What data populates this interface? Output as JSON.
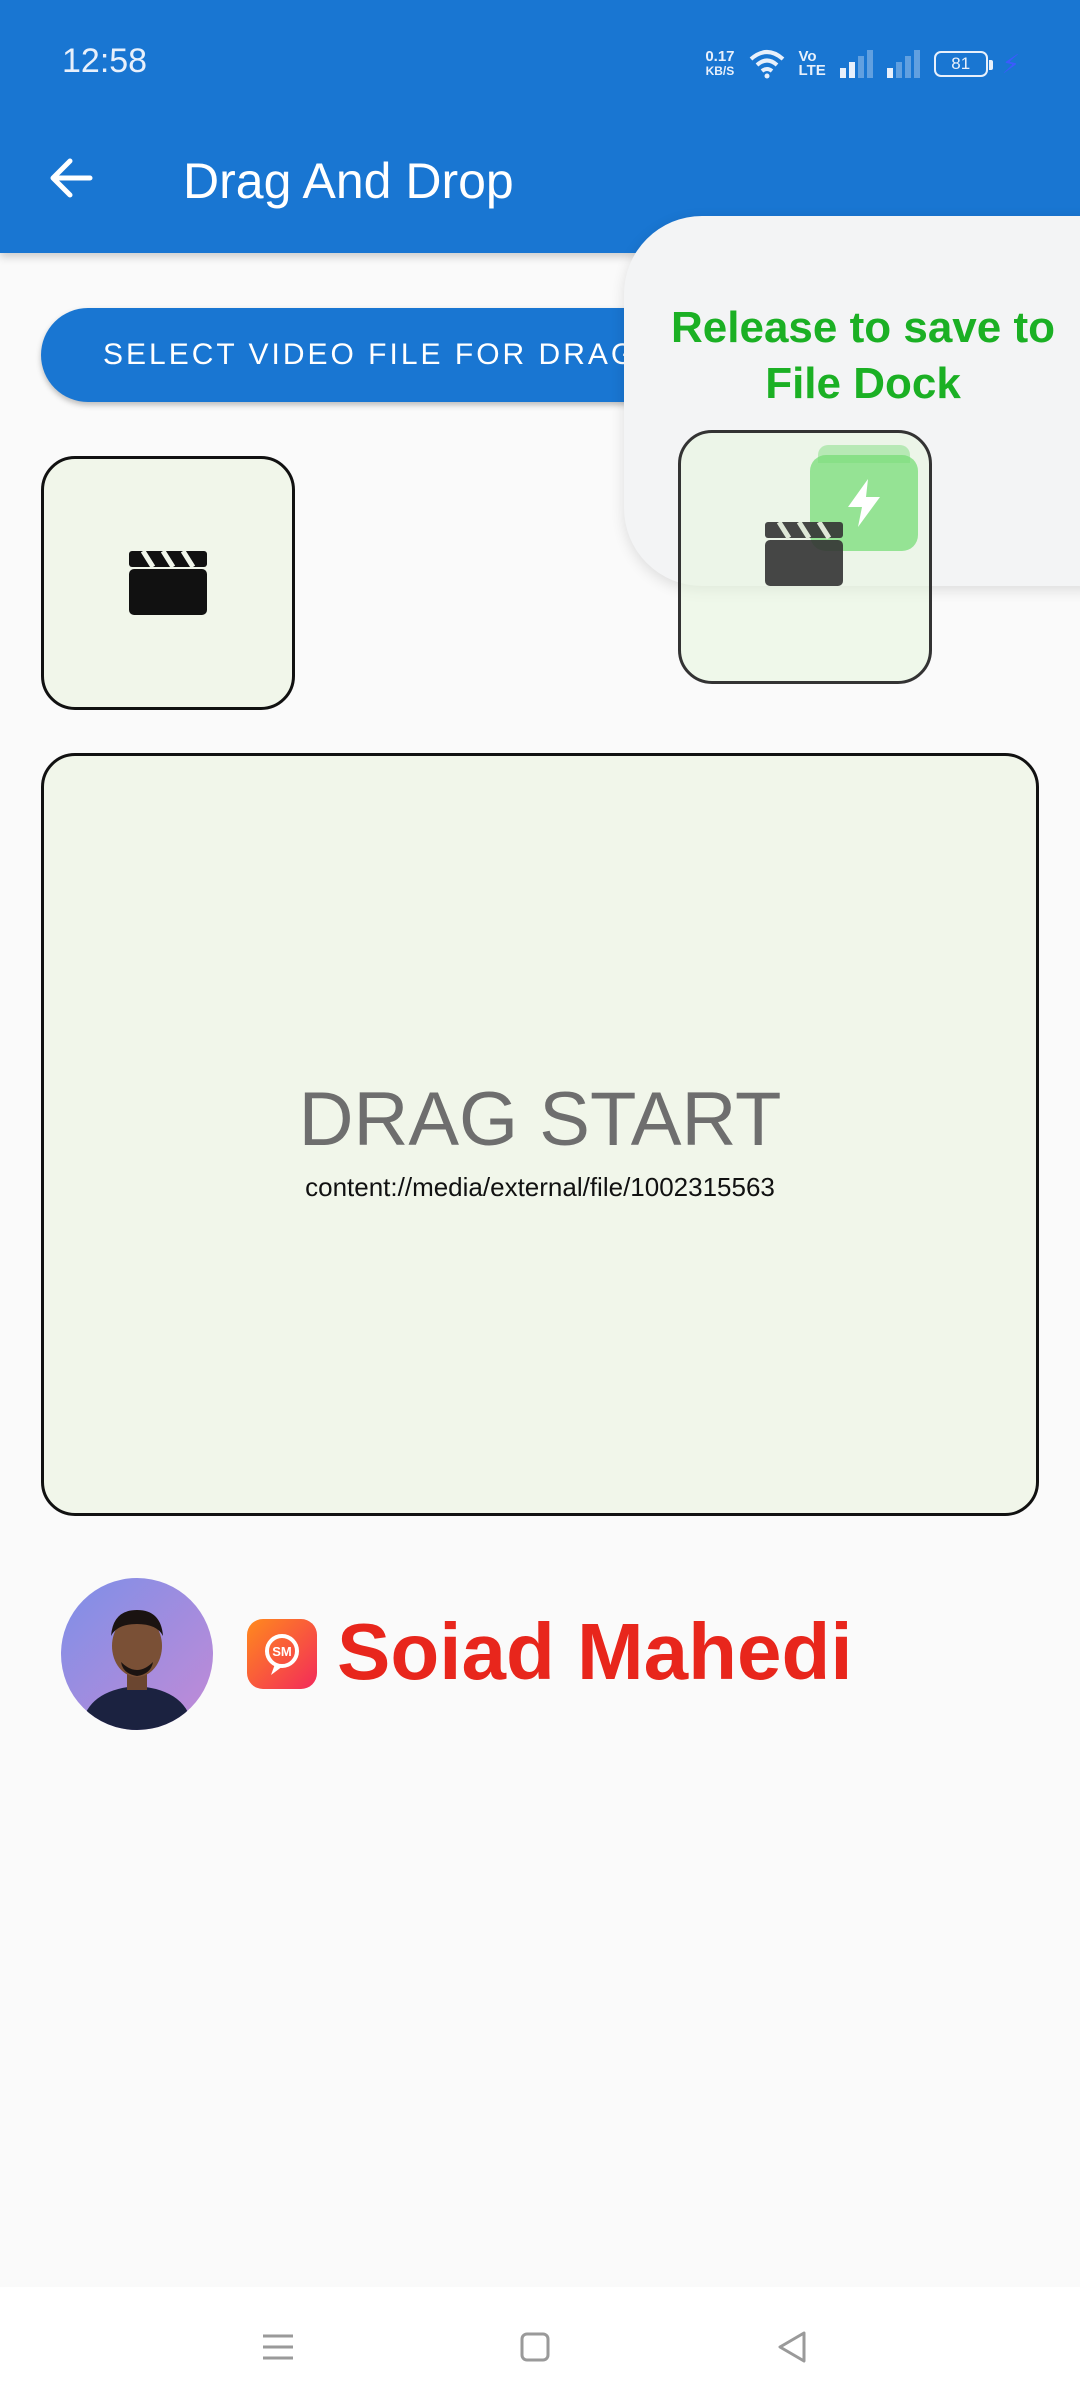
{
  "status_bar": {
    "time": "12:58",
    "net_speed_value": "0.17",
    "net_speed_unit": "KB/S",
    "volte_top": "Vo",
    "volte_bottom": "LTE",
    "battery": "81"
  },
  "app_bar": {
    "title": "Drag And Drop",
    "back_icon": "arrow-left-icon"
  },
  "select_button": {
    "label": "SELECT VIDEO FILE FOR DRAG"
  },
  "drop_area": {
    "title": "DRAG START",
    "uri": "content://media/external/file/1002315563"
  },
  "file_dock": {
    "message": "Release to save to File Dock",
    "icon": "file-dock-icon"
  },
  "author": {
    "name": "Soiad Mahedi",
    "logo_text": "SM"
  },
  "icons": {
    "video": "clapperboard-icon",
    "nav_menu": "menu-icon",
    "nav_home": "home-icon",
    "nav_back": "back-triangle-icon"
  },
  "colors": {
    "primary": "#1976d2",
    "dock_text": "#1bb024",
    "brand": "#e8261c",
    "box_fill": "#f1f6ea"
  }
}
